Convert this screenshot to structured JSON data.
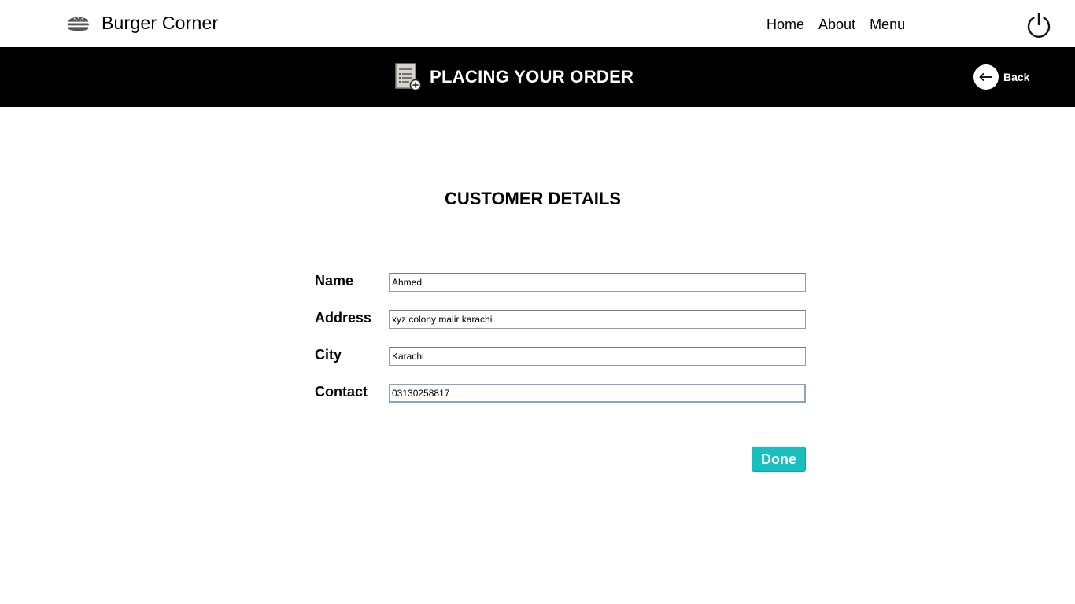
{
  "app": {
    "brand_name": "Burger Corner",
    "brand_icon": "burger-icon"
  },
  "nav": {
    "items": [
      {
        "label": "Home"
      },
      {
        "label": "About"
      },
      {
        "label": "Menu"
      }
    ],
    "power_icon": "power-icon"
  },
  "banner": {
    "icon": "order-list-icon",
    "title": "PLACING YOUR ORDER",
    "back_label": "Back",
    "back_icon": "arrow-left-icon",
    "background": "#000000"
  },
  "form": {
    "title": "CUSTOMER DETAILS",
    "fields": [
      {
        "label": "Name",
        "value": "Ahmed"
      },
      {
        "label": "Address",
        "value": "xyz colony malir karachi"
      },
      {
        "label": "City",
        "value": "Karachi"
      },
      {
        "label": "Contact",
        "value": "03130258817",
        "focused": true
      }
    ],
    "submit_label": "Done",
    "submit_color": "#17bfbf"
  }
}
